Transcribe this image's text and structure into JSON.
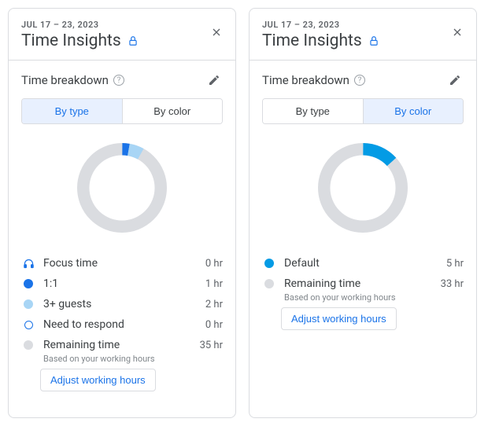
{
  "panels": [
    {
      "date_range": "JUL 17 – 23, 2023",
      "title": "Time Insights",
      "section_title": "Time breakdown",
      "tabs": {
        "by_type": "By type",
        "by_color": "By color",
        "active": "type"
      },
      "legend": [
        {
          "icon": "headphones",
          "label": "Focus time",
          "value": "0 hr",
          "color": "#1a73e8"
        },
        {
          "icon": "dot",
          "label": "1:1",
          "value": "1 hr",
          "color": "#1a73e8"
        },
        {
          "icon": "dot",
          "label": "3+ guests",
          "value": "2 hr",
          "color": "#a8d5f5"
        },
        {
          "icon": "ring",
          "label": "Need to respond",
          "value": "0 hr",
          "color": "#1a73e8"
        },
        {
          "icon": "dot",
          "label": "Remaining time",
          "value": "35 hr",
          "color": "#dadce0",
          "sub": "Based on your working hours",
          "adjust": "Adjust working hours"
        }
      ]
    },
    {
      "date_range": "JUL 17 – 23, 2023",
      "title": "Time Insights",
      "section_title": "Time breakdown",
      "tabs": {
        "by_type": "By type",
        "by_color": "By color",
        "active": "color"
      },
      "legend": [
        {
          "icon": "dot",
          "label": "Default",
          "value": "5 hr",
          "color": "#039be5"
        },
        {
          "icon": "dot",
          "label": "Remaining time",
          "value": "33 hr",
          "color": "#dadce0",
          "sub": "Based on your working hours",
          "adjust": "Adjust working hours"
        }
      ]
    }
  ],
  "chart_data": [
    {
      "type": "pie",
      "title": "Time breakdown — By type",
      "series": [
        {
          "name": "Focus time",
          "value": 0,
          "color": "#1a73e8"
        },
        {
          "name": "1:1",
          "value": 1,
          "color": "#1a73e8"
        },
        {
          "name": "3+ guests",
          "value": 2,
          "color": "#a8d5f5"
        },
        {
          "name": "Need to respond",
          "value": 0,
          "color": "#1a73e8"
        },
        {
          "name": "Remaining time",
          "value": 35,
          "color": "#dadce0"
        }
      ],
      "total_hours": 38
    },
    {
      "type": "pie",
      "title": "Time breakdown — By color",
      "series": [
        {
          "name": "Default",
          "value": 5,
          "color": "#039be5"
        },
        {
          "name": "Remaining time",
          "value": 33,
          "color": "#dadce0"
        }
      ],
      "total_hours": 38
    }
  ]
}
